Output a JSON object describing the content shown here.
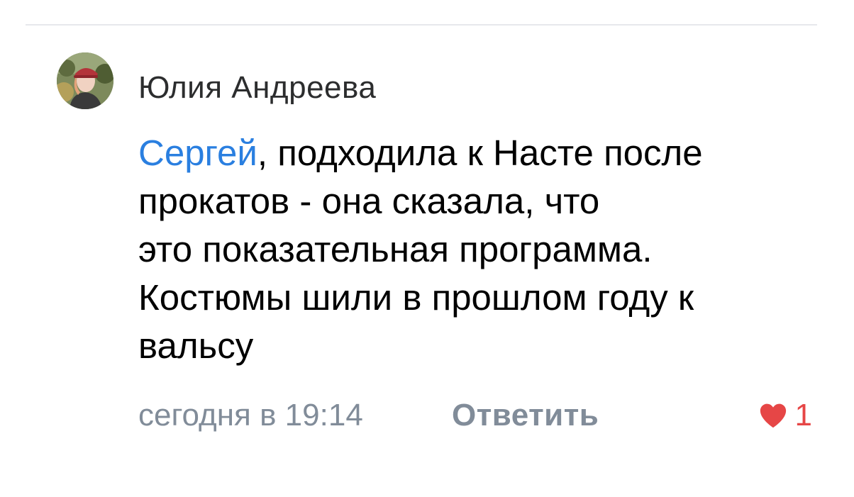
{
  "comment": {
    "author": "Юлия Андреева",
    "mention": "Сергей",
    "text_lines": [
      ", подходила к Насте после",
      "прокатов - она сказала, что",
      "это показательная программа.",
      "Костюмы шили в прошлом году к",
      "вальсу"
    ],
    "timestamp": "сегодня в 19:14",
    "reply_label": "Ответить",
    "likes": "1",
    "liked": true
  },
  "colors": {
    "mention": "#2a7fe0",
    "like": "#e64646",
    "meta": "#818c99",
    "author": "#2c2d2e"
  },
  "icons": {
    "like": "heart-icon",
    "avatar": "user-photo"
  }
}
